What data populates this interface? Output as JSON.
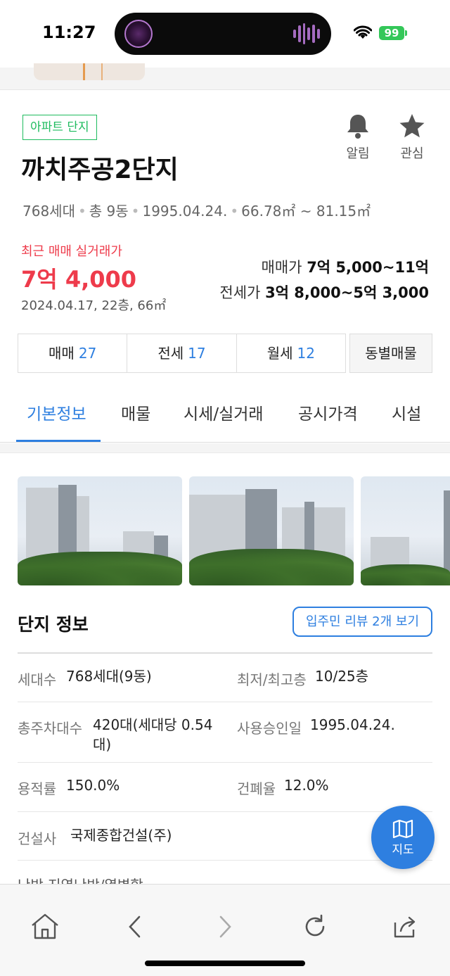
{
  "status": {
    "time": "11:27",
    "battery": "99"
  },
  "header": {
    "tag": "아파트 단지",
    "title": "까치주공2단지",
    "alarm_label": "알림",
    "interest_label": "관심",
    "meta": [
      "768세대",
      "총 9동",
      "1995.04.24.",
      "66.78㎡ ~ 81.15㎡"
    ]
  },
  "recent": {
    "label": "최근 매매 실거래가",
    "price": "7억 4,000",
    "detail": "2024.04.17, 22층, 66㎡"
  },
  "prices": {
    "sale_label": "매매가",
    "sale_value": "7억 5,000~11억",
    "jeonse_label": "전세가",
    "jeonse_value": "3억 8,000~5억 3,000"
  },
  "counts": [
    {
      "label": "매매",
      "count": "27"
    },
    {
      "label": "전세",
      "count": "17"
    },
    {
      "label": "월세",
      "count": "12"
    }
  ],
  "dong_button": "동별매물",
  "tabs": [
    "기본정보",
    "매물",
    "시세/실거래",
    "공시가격",
    "시설"
  ],
  "active_tab": "기본정보",
  "info": {
    "title": "단지 정보",
    "review_button": "입주민 리뷰 2개 보기",
    "rows": [
      {
        "k1": "세대수",
        "v1": "768세대(9동)",
        "k2": "최저/최고층",
        "v2": "10/25층"
      },
      {
        "k1": "총주차대수",
        "v1": "420대(세대당 0.54대)",
        "k2": "사용승인일",
        "v2": "1995.04.24."
      },
      {
        "k1": "용적률",
        "v1": "150.0%",
        "k2": "건폐율",
        "v2": "12.0%"
      },
      {
        "k1": "건설사",
        "v1": "국제종합건설(주)"
      }
    ],
    "cut_text": "난방   지역난방/열병합"
  },
  "map_button": "지도",
  "colors": {
    "accent": "#2e7fe0",
    "price_red": "#ee3b4b",
    "tag_green": "#1ebb5e"
  }
}
